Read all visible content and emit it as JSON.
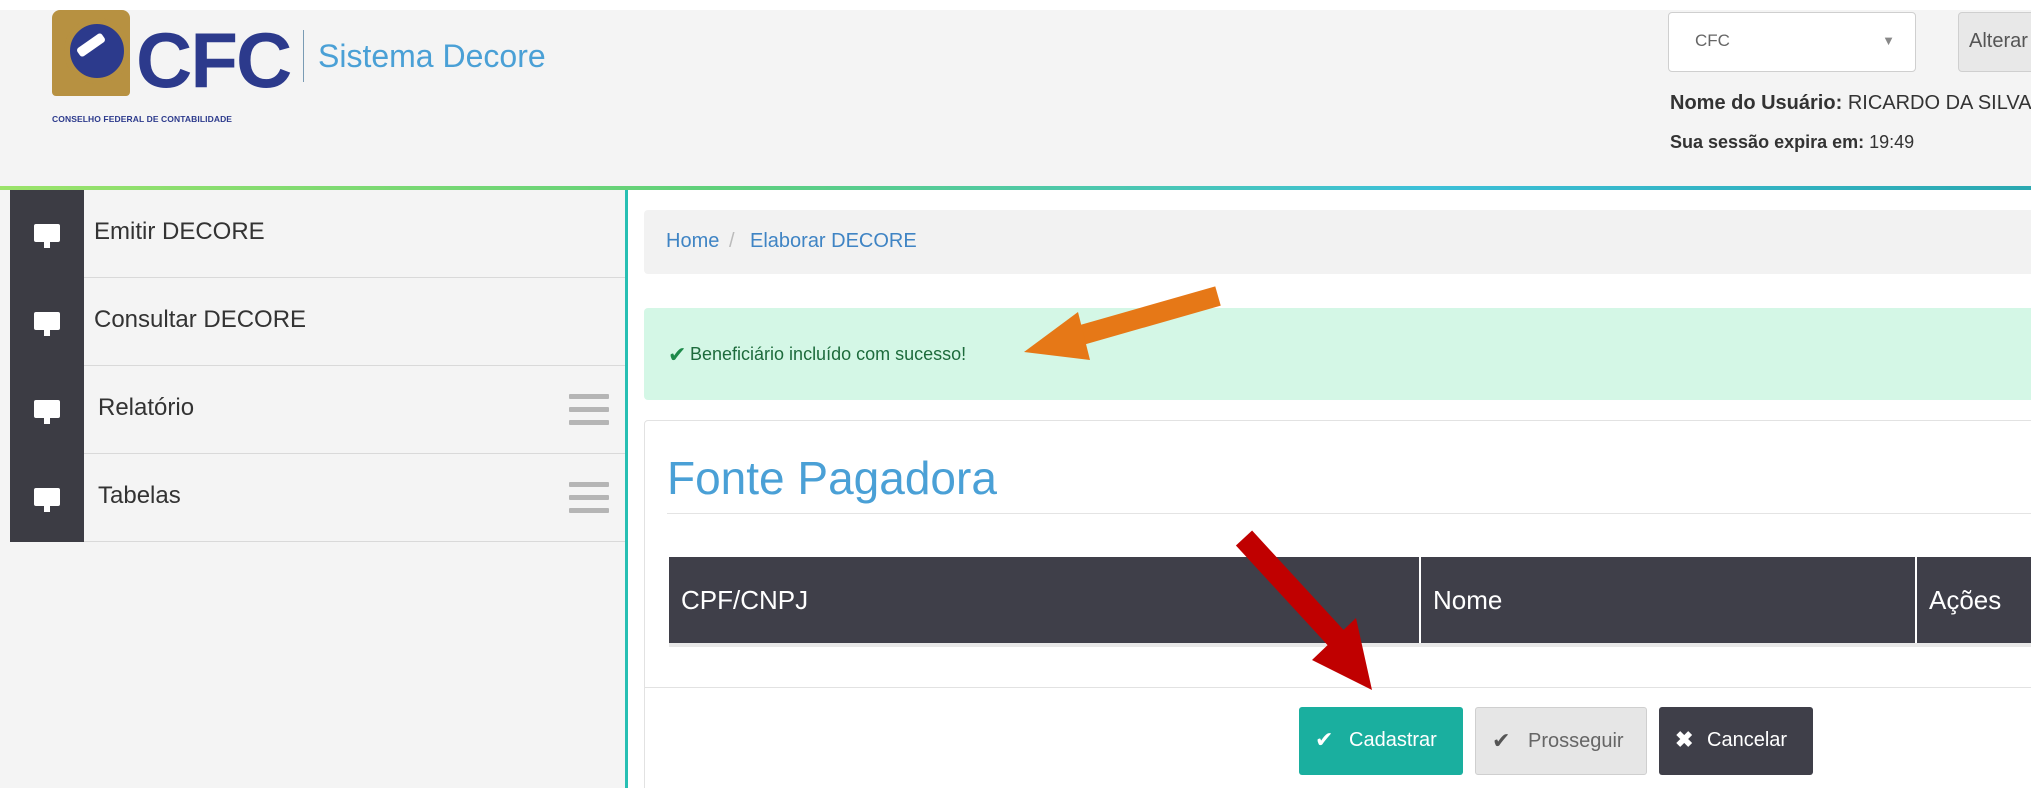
{
  "header": {
    "logo_text": "CFC",
    "logo_subtitle": "CONSELHO FEDERAL DE CONTABILIDADE",
    "system_name": "Sistema Decore",
    "org_select_value": "CFC",
    "alterar_label": "Alterar",
    "user_label": "Nome do Usuário:",
    "user_value": "RICARDO DA SILVA",
    "session_label": "Sua sessão expira em:",
    "session_value": "19:49"
  },
  "sidebar": {
    "items": [
      {
        "label": "Emitir DECORE",
        "icon": "monitor-icon"
      },
      {
        "label": "Consultar DECORE",
        "icon": "monitor-icon"
      },
      {
        "label": "Relatório",
        "icon": "monitor-icon",
        "menu": true
      },
      {
        "label": "Tabelas",
        "icon": "monitor-icon",
        "menu": true
      }
    ]
  },
  "breadcrumb": {
    "home": "Home",
    "separator": "/",
    "current": "Elaborar DECORE"
  },
  "alert": {
    "icon": "check-icon",
    "message": "Beneficiário incluído com sucesso!"
  },
  "panel": {
    "title": "Fonte Pagadora",
    "columns": [
      "CPF/CNPJ",
      "Nome",
      "Ações"
    ],
    "buttons": {
      "cadastrar": "Cadastrar",
      "prosseguir": "Prosseguir",
      "cancelar": "Cancelar"
    }
  },
  "colors": {
    "accent": "#27bfb3",
    "title_blue": "#4aa0d6",
    "dark_header": "#3f3f49",
    "success_bg": "#d4f7e6",
    "annotation_orange": "#e67817",
    "annotation_red": "#c00000"
  }
}
